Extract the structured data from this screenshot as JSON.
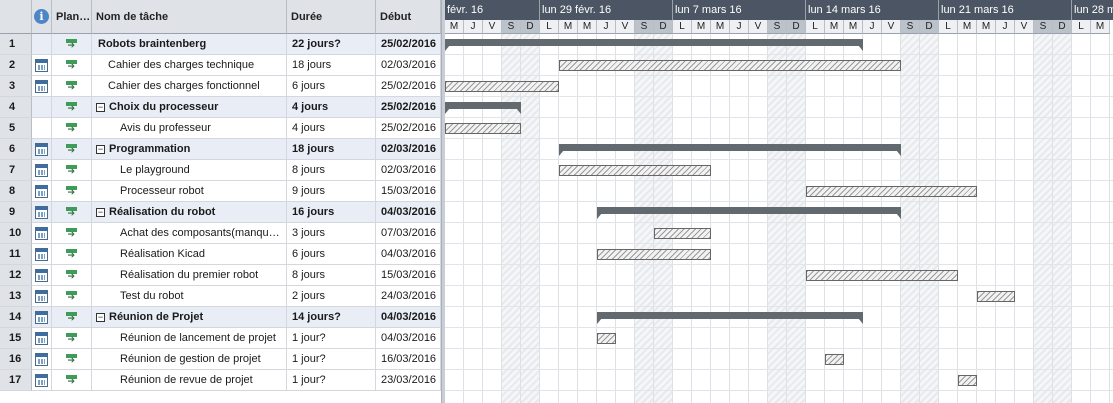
{
  "headers": {
    "num": "",
    "info": "i",
    "mode": "Plan…",
    "name": "Nom de tâche",
    "duration": "Durée",
    "start": "Début"
  },
  "tasks": [
    {
      "num": "1",
      "name": "Robots braintenberg",
      "duration": "22 jours?",
      "start": "25/02/2016",
      "summary": true,
      "level": 0,
      "collapse": false,
      "calendar": false,
      "startDay": 0,
      "days": 22
    },
    {
      "num": "2",
      "name": "Cahier des charges technique",
      "duration": "18 jours",
      "start": "02/03/2016",
      "summary": false,
      "level": 1,
      "calendar": true,
      "startDay": 6,
      "days": 18
    },
    {
      "num": "3",
      "name": "Cahier des charges fonctionnel",
      "duration": "6 jours",
      "start": "25/02/2016",
      "summary": false,
      "level": 1,
      "calendar": true,
      "startDay": 0,
      "days": 6
    },
    {
      "num": "4",
      "name": "Choix du processeur",
      "duration": "4 jours",
      "start": "25/02/2016",
      "summary": true,
      "level": 1,
      "collapse": true,
      "calendar": false,
      "startDay": 0,
      "days": 4
    },
    {
      "num": "5",
      "name": "Avis du professeur",
      "duration": "4 jours",
      "start": "25/02/2016",
      "summary": false,
      "level": 2,
      "calendar": false,
      "startDay": 0,
      "days": 4
    },
    {
      "num": "6",
      "name": "Programmation",
      "duration": "18 jours",
      "start": "02/03/2016",
      "summary": true,
      "level": 1,
      "collapse": true,
      "calendar": true,
      "startDay": 6,
      "days": 18
    },
    {
      "num": "7",
      "name": "Le playground",
      "duration": "8 jours",
      "start": "02/03/2016",
      "summary": false,
      "level": 2,
      "calendar": true,
      "startDay": 6,
      "days": 8
    },
    {
      "num": "8",
      "name": "Processeur robot",
      "duration": "9 jours",
      "start": "15/03/2016",
      "summary": false,
      "level": 2,
      "calendar": true,
      "startDay": 19,
      "days": 9
    },
    {
      "num": "9",
      "name": " Réalisation du robot",
      "duration": "16 jours",
      "start": "04/03/2016",
      "summary": true,
      "level": 1,
      "collapse": true,
      "calendar": true,
      "startDay": 8,
      "days": 16
    },
    {
      "num": "10",
      "name": "Achat des composants(manqu…",
      "duration": "3 jours",
      "start": "07/03/2016",
      "summary": false,
      "level": 2,
      "calendar": true,
      "startDay": 11,
      "days": 3
    },
    {
      "num": "11",
      "name": "Réalisation Kicad",
      "duration": "6 jours",
      "start": "04/03/2016",
      "summary": false,
      "level": 2,
      "calendar": true,
      "startDay": 8,
      "days": 6
    },
    {
      "num": "12",
      "name": "Réalisation du premier robot",
      "duration": "8 jours",
      "start": "15/03/2016",
      "summary": false,
      "level": 2,
      "calendar": true,
      "startDay": 19,
      "days": 8
    },
    {
      "num": "13",
      "name": "Test du robot",
      "duration": "2 jours",
      "start": "24/03/2016",
      "summary": false,
      "level": 2,
      "calendar": true,
      "startDay": 28,
      "days": 2
    },
    {
      "num": "14",
      "name": "Réunion de Projet",
      "duration": "14 jours?",
      "start": "04/03/2016",
      "summary": true,
      "level": 1,
      "collapse": true,
      "calendar": true,
      "startDay": 8,
      "days": 14
    },
    {
      "num": "15",
      "name": "Réunion de lancement de projet",
      "duration": "1 jour?",
      "start": "04/03/2016",
      "summary": false,
      "level": 2,
      "calendar": true,
      "startDay": 8,
      "days": 1
    },
    {
      "num": "16",
      "name": "Réunion de gestion de projet",
      "duration": "1 jour?",
      "start": "16/03/2016",
      "summary": false,
      "level": 2,
      "calendar": true,
      "startDay": 20,
      "days": 1
    },
    {
      "num": "17",
      "name": "Réunion de revue de projet",
      "duration": "1 jour?",
      "start": "23/03/2016",
      "summary": false,
      "level": 2,
      "calendar": true,
      "startDay": 27,
      "days": 1
    }
  ],
  "timeline": {
    "weeks": [
      "févr. 16",
      "lun 29 févr. 16",
      "lun 7 mars 16",
      "lun 14 mars 16",
      "lun 21 mars 16",
      "lun 28 m"
    ],
    "days": [
      "M",
      "J",
      "V",
      "S",
      "D",
      "L",
      "M",
      "M",
      "J",
      "V",
      "S",
      "D",
      "L",
      "M",
      "M",
      "J",
      "V",
      "S",
      "D",
      "L",
      "M",
      "M",
      "J",
      "V",
      "S",
      "D",
      "L",
      "M",
      "M",
      "J",
      "V",
      "S",
      "D",
      "L",
      "M"
    ],
    "weekends": [
      "S",
      "D"
    ]
  },
  "colors": {
    "header_bg": "#dfe3e8",
    "summary_row_bg": "#e8edf6",
    "timescale_bg": "#4b5563",
    "summary_bar": "#626a70"
  }
}
